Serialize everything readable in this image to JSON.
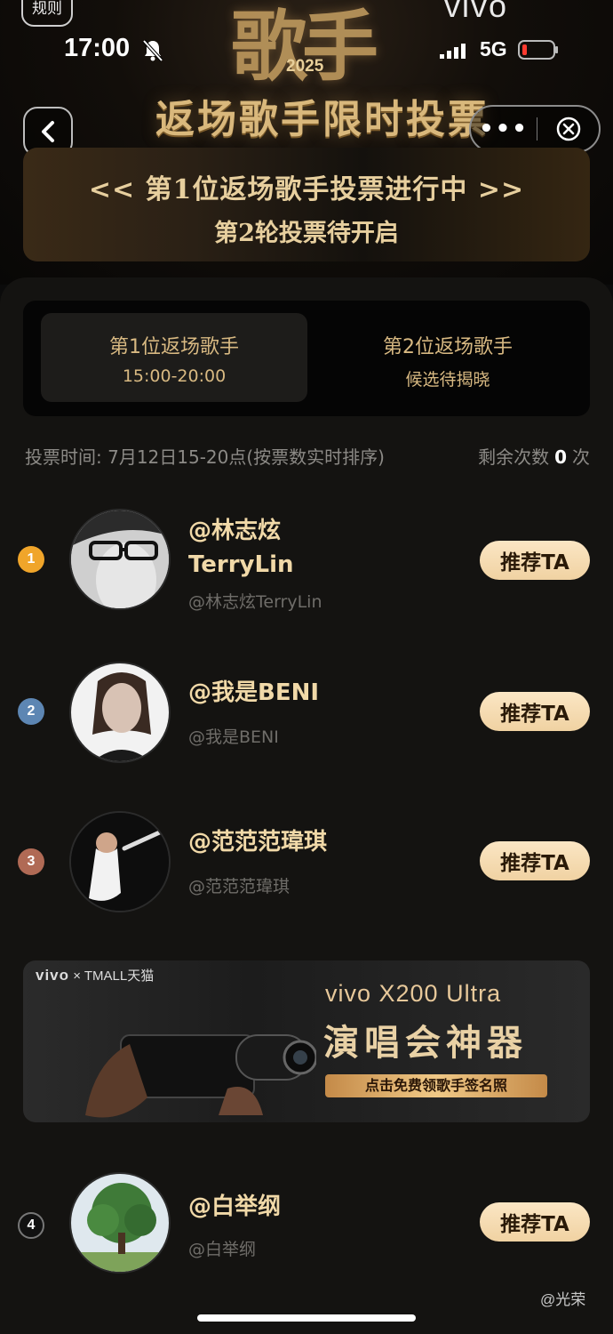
{
  "status_bar": {
    "time": "17:00",
    "network": "5G"
  },
  "header": {
    "rules_label": "规则",
    "show_logo": "歌手",
    "show_year": "2025",
    "brand": "vivo",
    "headline": "返场歌手限时投票",
    "more_label": "•••"
  },
  "status_card": {
    "line1": "<< 第1位返场歌手投票进行中 >>",
    "line2": "第2轮投票待开启"
  },
  "tabs": [
    {
      "title": "第1位返场歌手",
      "subtitle": "15:00-20:00",
      "active": true
    },
    {
      "title": "第2位返场歌手",
      "subtitle": "候选待揭晓",
      "active": false
    }
  ],
  "vote_info": {
    "text": "投票时间: 7月12日15-20点(按票数实时排序)",
    "remaining_label": "剩余次数",
    "remaining_count": "0",
    "remaining_unit": "次"
  },
  "candidates": [
    {
      "rank": "1",
      "name_line1": "@林志炫",
      "name_line2": "TerryLin",
      "handle": "@林志炫TerryLin",
      "button": "推荐TA",
      "badge_color": "#f0a52a"
    },
    {
      "rank": "2",
      "name_line1": "@我是BENI",
      "handle": "@我是BENI",
      "button": "推荐TA",
      "badge_color": "#5d86b3"
    },
    {
      "rank": "3",
      "name_line1": "@范范范瑋琪",
      "handle": "@范范范瑋琪",
      "button": "推荐TA",
      "badge_color": "#b06a55"
    },
    {
      "rank": "4",
      "name_line1": "@白举纲",
      "handle": "@白举纲",
      "button": "推荐TA",
      "badge_color": "#111111"
    }
  ],
  "ad": {
    "brand": "vivo",
    "partner": "× TMALL天猫",
    "title": "vivo X200 Ultra",
    "slogan": "演唱会神器",
    "cta": "点击免费领歌手签名照"
  },
  "watermark": "@光荣"
}
